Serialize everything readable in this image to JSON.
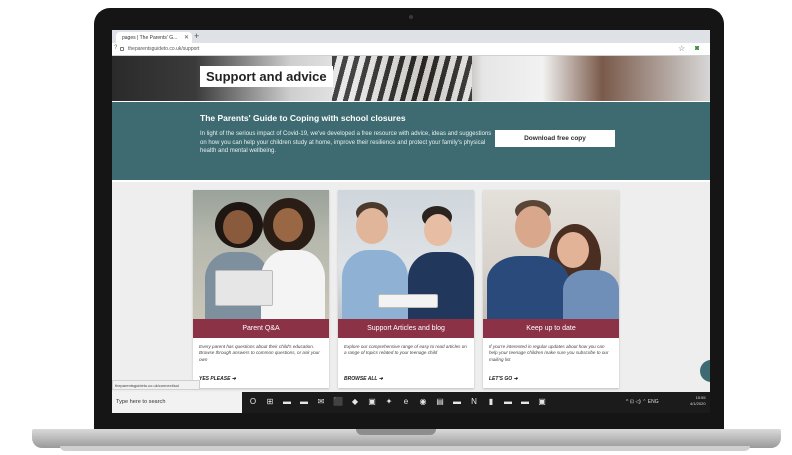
{
  "browser": {
    "tab_title": "pages | The Parents' G...",
    "tab_close": "✕",
    "new_tab": "+",
    "back_symbol": "?",
    "url": "theparentsguideto.co.uk/support",
    "star": "☆",
    "extension": "◙"
  },
  "hero": {
    "title": "Support and advice"
  },
  "banner": {
    "title": "The Parents' Guide to Coping with school closures",
    "text": "In light of the serious impact of Covid-19, we've developed a free resource with advice, ideas and suggestions on how you can help your children study at home, improve their resilience and protect your family's physical health and mental wellbeing.",
    "button_label": "Download free copy"
  },
  "cards": [
    {
      "label": "Parent Q&A",
      "text": "Every parent has questions about their child's education. Browse through answers to common questions, or ask your own",
      "link": "YES PLEASE  ➜"
    },
    {
      "label": "Support Articles and blog",
      "text": "Explore our comprehensive range of easy to read articles on a range of topics related to your teenage child",
      "link": "BROWSE ALL  ➜"
    },
    {
      "label": "Keep up to date",
      "text": "If you're interested in regular updates about how you can help your teenage children make sure you subscribe to our mailing list",
      "link": "LET'S GO  ➜"
    }
  ],
  "status_tooltip": "theparentsguideto.co.uk/connect/sui",
  "taskbar": {
    "search_placeholder": "Type here to search",
    "icons": [
      "O",
      "⊞",
      "▬",
      "▬",
      "✉",
      "⬛",
      "◆",
      "▣",
      "✦",
      "e",
      "◉",
      "▤",
      "▬",
      "N",
      "▮",
      "▬",
      "▬",
      "▣"
    ],
    "tray": "^ ⊡ ◁) ⌃ ENG",
    "clock_time": "15:55",
    "clock_date": "4/1/2020"
  },
  "colors": {
    "banner": "#3e6b72",
    "card_label": "#8c3246",
    "taskbar": "#1b1b1b"
  }
}
